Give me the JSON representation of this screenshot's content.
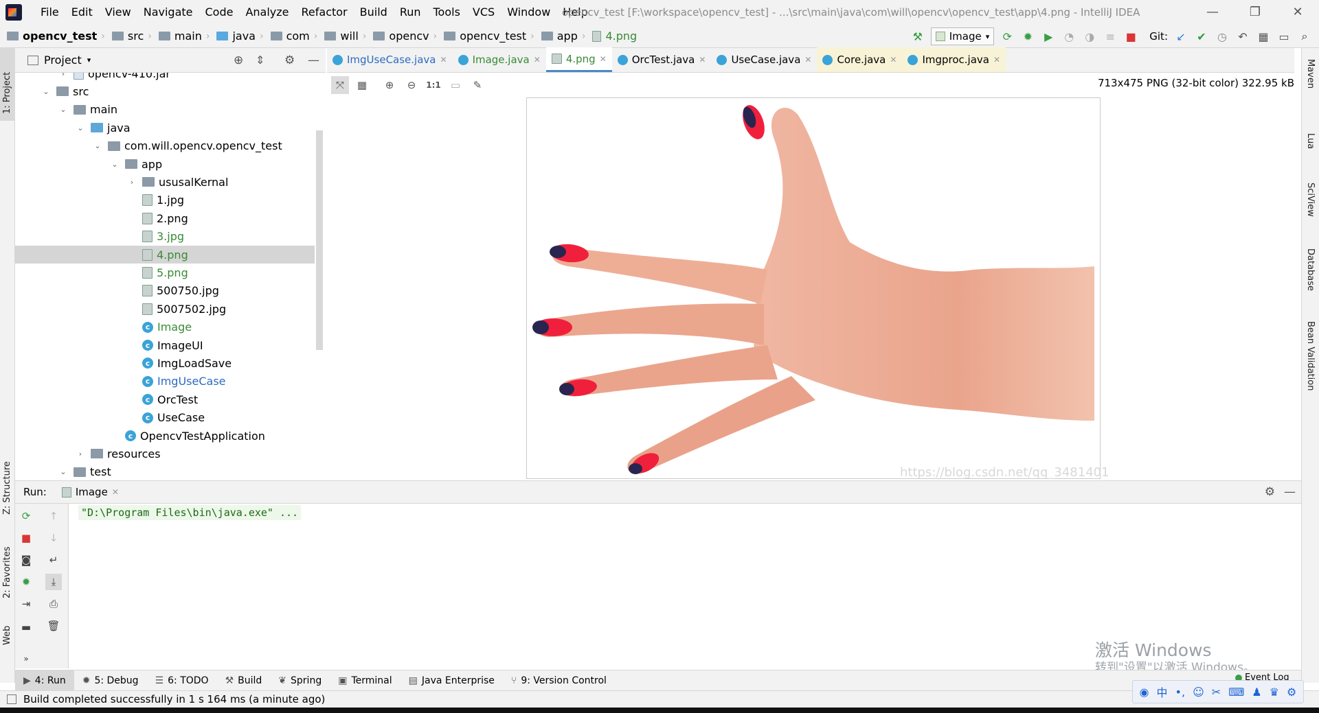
{
  "window": {
    "title": "opencv_test [F:\\workspace\\opencv_test] - ...\\src\\main\\java\\com\\will\\opencv\\opencv_test\\app\\4.png - IntelliJ IDEA",
    "minimize": "—",
    "restore": "❐",
    "close": "✕"
  },
  "menu": [
    "File",
    "Edit",
    "View",
    "Navigate",
    "Code",
    "Analyze",
    "Refactor",
    "Build",
    "Run",
    "Tools",
    "VCS",
    "Window",
    "Help"
  ],
  "breadcrumb": [
    "opencv_test",
    "src",
    "main",
    "java",
    "com",
    "will",
    "opencv",
    "opencv_test",
    "app",
    "4.png"
  ],
  "toolbar": {
    "run_config": "Image",
    "git_label": "Git:"
  },
  "project_panel": {
    "title": "Project",
    "tree": [
      {
        "label": "opencv-410.jar",
        "kind": "jar",
        "indent": 1,
        "arrow": "›",
        "color": "normal"
      },
      {
        "label": "src",
        "kind": "folder",
        "indent": 0,
        "arrow": "⌄",
        "color": "normal"
      },
      {
        "label": "main",
        "kind": "folder",
        "indent": 1,
        "arrow": "⌄",
        "color": "normal"
      },
      {
        "label": "java",
        "kind": "folder-blue",
        "indent": 2,
        "arrow": "⌄",
        "color": "normal"
      },
      {
        "label": "com.will.opencv.opencv_test",
        "kind": "folder",
        "indent": 3,
        "arrow": "⌄",
        "color": "normal"
      },
      {
        "label": "app",
        "kind": "folder",
        "indent": 4,
        "arrow": "⌄",
        "color": "normal"
      },
      {
        "label": "ususalKernal",
        "kind": "folder",
        "indent": 5,
        "arrow": "›",
        "color": "normal"
      },
      {
        "label": "1.jpg",
        "kind": "image",
        "indent": 5,
        "arrow": "",
        "color": "normal"
      },
      {
        "label": "2.png",
        "kind": "image",
        "indent": 5,
        "arrow": "",
        "color": "normal"
      },
      {
        "label": "3.jpg",
        "kind": "image",
        "indent": 5,
        "arrow": "",
        "color": "green"
      },
      {
        "label": "4.png",
        "kind": "image",
        "indent": 5,
        "arrow": "",
        "color": "green",
        "selected": true
      },
      {
        "label": "5.png",
        "kind": "image",
        "indent": 5,
        "arrow": "",
        "color": "green"
      },
      {
        "label": "500750.jpg",
        "kind": "image",
        "indent": 5,
        "arrow": "",
        "color": "normal"
      },
      {
        "label": "5007502.jpg",
        "kind": "image",
        "indent": 5,
        "arrow": "",
        "color": "normal"
      },
      {
        "label": "Image",
        "kind": "class",
        "indent": 5,
        "arrow": "",
        "color": "green"
      },
      {
        "label": "ImageUI",
        "kind": "class",
        "indent": 5,
        "arrow": "",
        "color": "normal"
      },
      {
        "label": "ImgLoadSave",
        "kind": "class",
        "indent": 5,
        "arrow": "",
        "color": "normal"
      },
      {
        "label": "ImgUseCase",
        "kind": "class",
        "indent": 5,
        "arrow": "",
        "color": "blue"
      },
      {
        "label": "OrcTest",
        "kind": "class",
        "indent": 5,
        "arrow": "",
        "color": "normal"
      },
      {
        "label": "UseCase",
        "kind": "class",
        "indent": 5,
        "arrow": "",
        "color": "normal"
      },
      {
        "label": "OpencvTestApplication",
        "kind": "class",
        "indent": 4,
        "arrow": "",
        "color": "normal"
      },
      {
        "label": "resources",
        "kind": "folder",
        "indent": 2,
        "arrow": "›",
        "color": "normal"
      },
      {
        "label": "test",
        "kind": "folder",
        "indent": 1,
        "arrow": "⌄",
        "color": "normal"
      }
    ]
  },
  "editor_tabs": [
    {
      "label": "ImgUseCase.java",
      "color": "blue",
      "icon": "class"
    },
    {
      "label": "Image.java",
      "color": "green",
      "icon": "class"
    },
    {
      "label": "4.png",
      "color": "green",
      "icon": "image",
      "active": true
    },
    {
      "label": "OrcTest.java",
      "color": "normal",
      "icon": "class"
    },
    {
      "label": "UseCase.java",
      "color": "normal",
      "icon": "class"
    },
    {
      "label": "Core.java",
      "color": "normal",
      "icon": "class",
      "highlight": true
    },
    {
      "label": "Imgproc.java",
      "color": "normal",
      "icon": "class",
      "highlight": true
    }
  ],
  "image_viewer": {
    "info": "713x475 PNG (32-bit color) 322.95 kB",
    "actual_size_label": "1:1",
    "watermark": "https://blog.csdn.net/qq_3481401"
  },
  "right_strip": [
    "Maven",
    "Lua",
    "SciView",
    "Database",
    "Bean Validation"
  ],
  "left_strip": [
    "1: Project",
    "Z: Structure",
    "2: Favorites",
    "Web"
  ],
  "run_panel": {
    "label": "Run:",
    "tab": "Image",
    "command": "\"D:\\Program Files\\bin\\java.exe\" ..."
  },
  "os_overlay": {
    "activate_title": "激活 Windows",
    "activate_sub": "转到\"设置\"以激活 Windows。"
  },
  "bottom_tools": [
    {
      "label": "4: Run",
      "icon": "run-icon",
      "active": true
    },
    {
      "label": "5: Debug",
      "icon": "debug-icon"
    },
    {
      "label": "6: TODO",
      "icon": "todo-icon"
    },
    {
      "label": "Build",
      "icon": "build-icon"
    },
    {
      "label": "Spring",
      "icon": "spring-icon"
    },
    {
      "label": "Terminal",
      "icon": "terminal-icon"
    },
    {
      "label": "Java Enterprise",
      "icon": "enterprise-icon"
    },
    {
      "label": "9: Version Control",
      "icon": "vcs-icon"
    }
  ],
  "event_log": "Event Log",
  "status": "Build completed successfully in 1 s 164 ms (a minute ago)",
  "colors": {
    "panel_bg": "#f2f2f2",
    "selection": "#d5d5d5",
    "green_file": "#388a34",
    "blue_file": "#2c6bc0",
    "active_tab": "#4a88c7",
    "nail": "#f0203c"
  }
}
